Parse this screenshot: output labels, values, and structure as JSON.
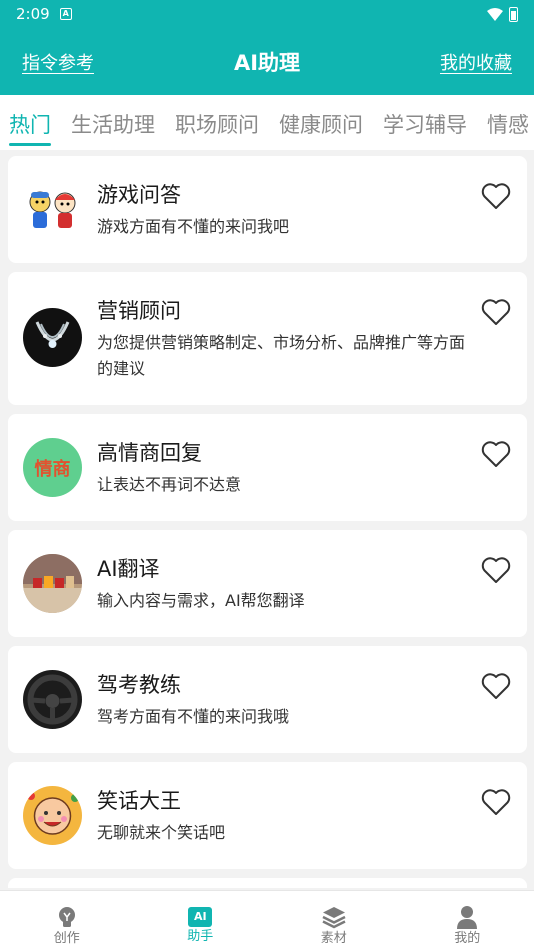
{
  "status_bar": {
    "time": "2:09"
  },
  "header": {
    "left_link": "指令参考",
    "title": "AI助理",
    "right_link": "我的收藏"
  },
  "tabs": [
    {
      "label": "热门",
      "active": true
    },
    {
      "label": "生活助理"
    },
    {
      "label": "职场顾问"
    },
    {
      "label": "健康顾问"
    },
    {
      "label": "学习辅导"
    },
    {
      "label": "情感"
    }
  ],
  "assistants": [
    {
      "title": "游戏问答",
      "desc": "游戏方面有不懂的来问我吧",
      "avatar": "game-characters-avatar"
    },
    {
      "title": "营销顾问",
      "desc": "为您提供营销策略制定、市场分析、品牌推广等方面的建议",
      "avatar": "necklace-avatar"
    },
    {
      "title": "高情商回复",
      "desc": "让表达不再词不达意",
      "avatar": "eq-text-avatar",
      "avatar_text": "情商"
    },
    {
      "title": "AI翻译",
      "desc": "输入内容与需求，AI帮您翻译",
      "avatar": "letter-blocks-avatar"
    },
    {
      "title": "驾考教练",
      "desc": "驾考方面有不懂的来问我哦",
      "avatar": "steering-wheel-avatar"
    },
    {
      "title": "笑话大王",
      "desc": "无聊就来个笑话吧",
      "avatar": "cartoon-face-avatar"
    }
  ],
  "bottom_nav": [
    {
      "label": "创作",
      "icon": "bulb-icon"
    },
    {
      "label": "助手",
      "icon": "ai-icon",
      "icon_text": "AI",
      "active": true
    },
    {
      "label": "素材",
      "icon": "layers-icon"
    },
    {
      "label": "我的",
      "icon": "person-icon"
    }
  ],
  "colors": {
    "accent": "#10b5b1",
    "background": "#f2f2f2"
  }
}
